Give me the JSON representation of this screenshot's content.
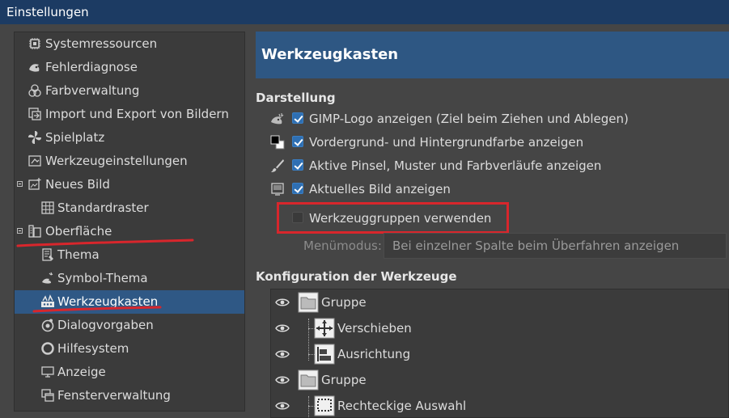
{
  "window": {
    "title": "Einstellungen"
  },
  "sidebar": {
    "items": [
      {
        "label": "Systemressourcen",
        "icon": "chip-icon"
      },
      {
        "label": "Fehlerdiagnose",
        "icon": "bug-wilber-icon"
      },
      {
        "label": "Farbverwaltung",
        "icon": "color-circles-icon"
      },
      {
        "label": "Import und Export von Bildern",
        "icon": "import-export-icon"
      },
      {
        "label": "Spielplatz",
        "icon": "pinwheel-icon"
      },
      {
        "label": "Werkzeugeinstellungen",
        "icon": "tool-options-icon"
      },
      {
        "label": "Neues Bild",
        "icon": "new-image-icon"
      },
      {
        "label": "Standardraster",
        "icon": "grid-icon"
      },
      {
        "label": "Oberfläche",
        "icon": "interface-icon"
      },
      {
        "label": "Thema",
        "icon": "theme-icon"
      },
      {
        "label": "Symbol-Thema",
        "icon": "icon-theme-icon"
      },
      {
        "label": "Werkzeugkasten",
        "icon": "toolbox-icon",
        "selected": true
      },
      {
        "label": "Dialogvorgaben",
        "icon": "dialog-defaults-icon"
      },
      {
        "label": "Hilfesystem",
        "icon": "help-ring-icon"
      },
      {
        "label": "Anzeige",
        "icon": "display-icon"
      },
      {
        "label": "Fensterverwaltung",
        "icon": "window-management-icon"
      }
    ]
  },
  "content": {
    "header": "Werkzeugkasten",
    "appearance": {
      "title": "Darstellung",
      "options": [
        {
          "label": "GIMP-Logo anzeigen (Ziel beim Ziehen und Ablegen)",
          "checked": true,
          "icon": "wilber-icon"
        },
        {
          "label": "Vordergrund- und Hintergrundfarbe anzeigen",
          "checked": true,
          "icon": "fg-bg-color-icon"
        },
        {
          "label": "Aktive Pinsel, Muster und Farbverläufe anzeigen",
          "checked": true,
          "icon": "brush-icon"
        },
        {
          "label": "Aktuelles Bild anzeigen",
          "checked": true,
          "icon": "image-icon"
        },
        {
          "label": "Werkzeuggruppen verwenden",
          "checked": false,
          "icon": ""
        }
      ],
      "menu_mode_label": "Menümodus:",
      "menu_mode_value": "Bei einzelner Spalte beim Überfahren anzeigen"
    },
    "tools_config": {
      "title": "Konfiguration der Werkzeuge",
      "rows": [
        {
          "label": "Gruppe",
          "icon": "folder-icon",
          "level": 0
        },
        {
          "label": "Verschieben",
          "icon": "move-tool-icon",
          "level": 1
        },
        {
          "label": "Ausrichtung",
          "icon": "align-tool-icon",
          "level": 1
        },
        {
          "label": "Gruppe",
          "icon": "folder-icon",
          "level": 0
        },
        {
          "label": "Rechteckige Auswahl",
          "icon": "rect-select-icon",
          "level": 1
        }
      ]
    }
  },
  "colors": {
    "accent": "#2e5783",
    "annotation": "#d8262c",
    "checkbox": "#2e6fb3"
  }
}
